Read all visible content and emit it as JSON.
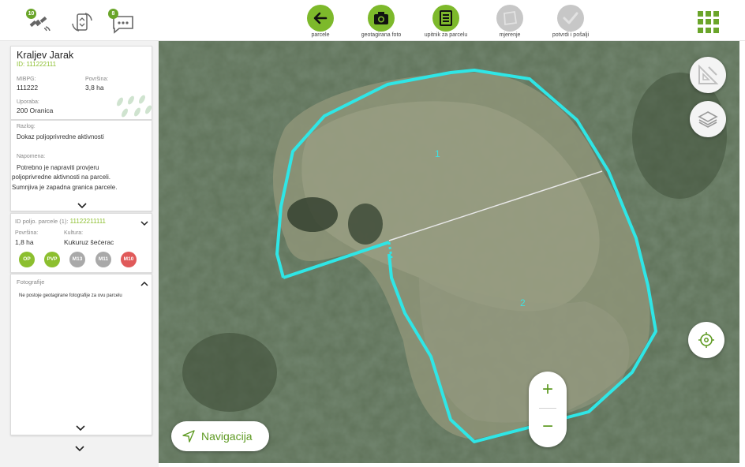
{
  "topbar": {
    "status": [
      {
        "icon": "satellite-icon",
        "badge": "10"
      },
      {
        "icon": "sync-phone-icon",
        "badge": ""
      },
      {
        "icon": "chat-icon",
        "badge": "8"
      }
    ],
    "tools": [
      {
        "label": "parcele",
        "icon": "arrow-left-icon",
        "state": "active"
      },
      {
        "label": "geotagirana foto",
        "icon": "camera-icon",
        "state": "active"
      },
      {
        "label": "upitnik za parcelu",
        "icon": "questionnaire-icon",
        "state": "active"
      },
      {
        "label": "mjerenje",
        "icon": "measure-icon",
        "state": "disabled"
      },
      {
        "label": "potvrdi i pošalji",
        "icon": "check-icon",
        "state": "disabled"
      }
    ],
    "menu_icon": "grid-menu-icon"
  },
  "farm": {
    "name": "Kraljev Jarak",
    "id_text": "ID: 111222111",
    "mibpg_label": "MIBPG:",
    "mibpg_value": "111222",
    "area_label": "Površina:",
    "area_value": "3,8 ha",
    "use_label": "Uporaba:",
    "use_value": "200 Oranica"
  },
  "reason": {
    "label": "Razlog:",
    "value": "Dokaz poljoprivredne aktivnosti",
    "note_label": "Napomena:",
    "note_lines": {
      "l1": "Potrebno je napraviti provjeru",
      "l2": "poljoprivredne aktivnosti na parceli.",
      "l3": "Sumnjiva je zapadna granica parcele."
    }
  },
  "subparcel": {
    "id_label": "ID poljo. parcele (1):",
    "id_value": "11122211111",
    "area_label": "Površina:",
    "area_value": "1,8 ha",
    "crop_label": "Kultura:",
    "crop_value": "Kukuruz šećerac",
    "tags": [
      {
        "label": "OP",
        "color": "#8cbf2f"
      },
      {
        "label": "PVP",
        "color": "#8cbf2f"
      },
      {
        "label": "M13",
        "color": "#a9a9a9"
      },
      {
        "label": "M11",
        "color": "#a9a9a9"
      },
      {
        "label": "M10",
        "color": "#e05a5a"
      }
    ]
  },
  "photos": {
    "title": "Fotografije",
    "empty_text": "Ne postoje geotagirane fotografije za ovu parcelu"
  },
  "map": {
    "navigation_label": "Navigacija",
    "zone_labels": [
      "1",
      "2"
    ],
    "boundary_color": "#2fe6e6",
    "zoom_in": "+",
    "zoom_out": "−"
  },
  "colors": {
    "accent": "#7db92b",
    "accent_text": "#5e9a22",
    "disabled": "#c7c7c7"
  }
}
